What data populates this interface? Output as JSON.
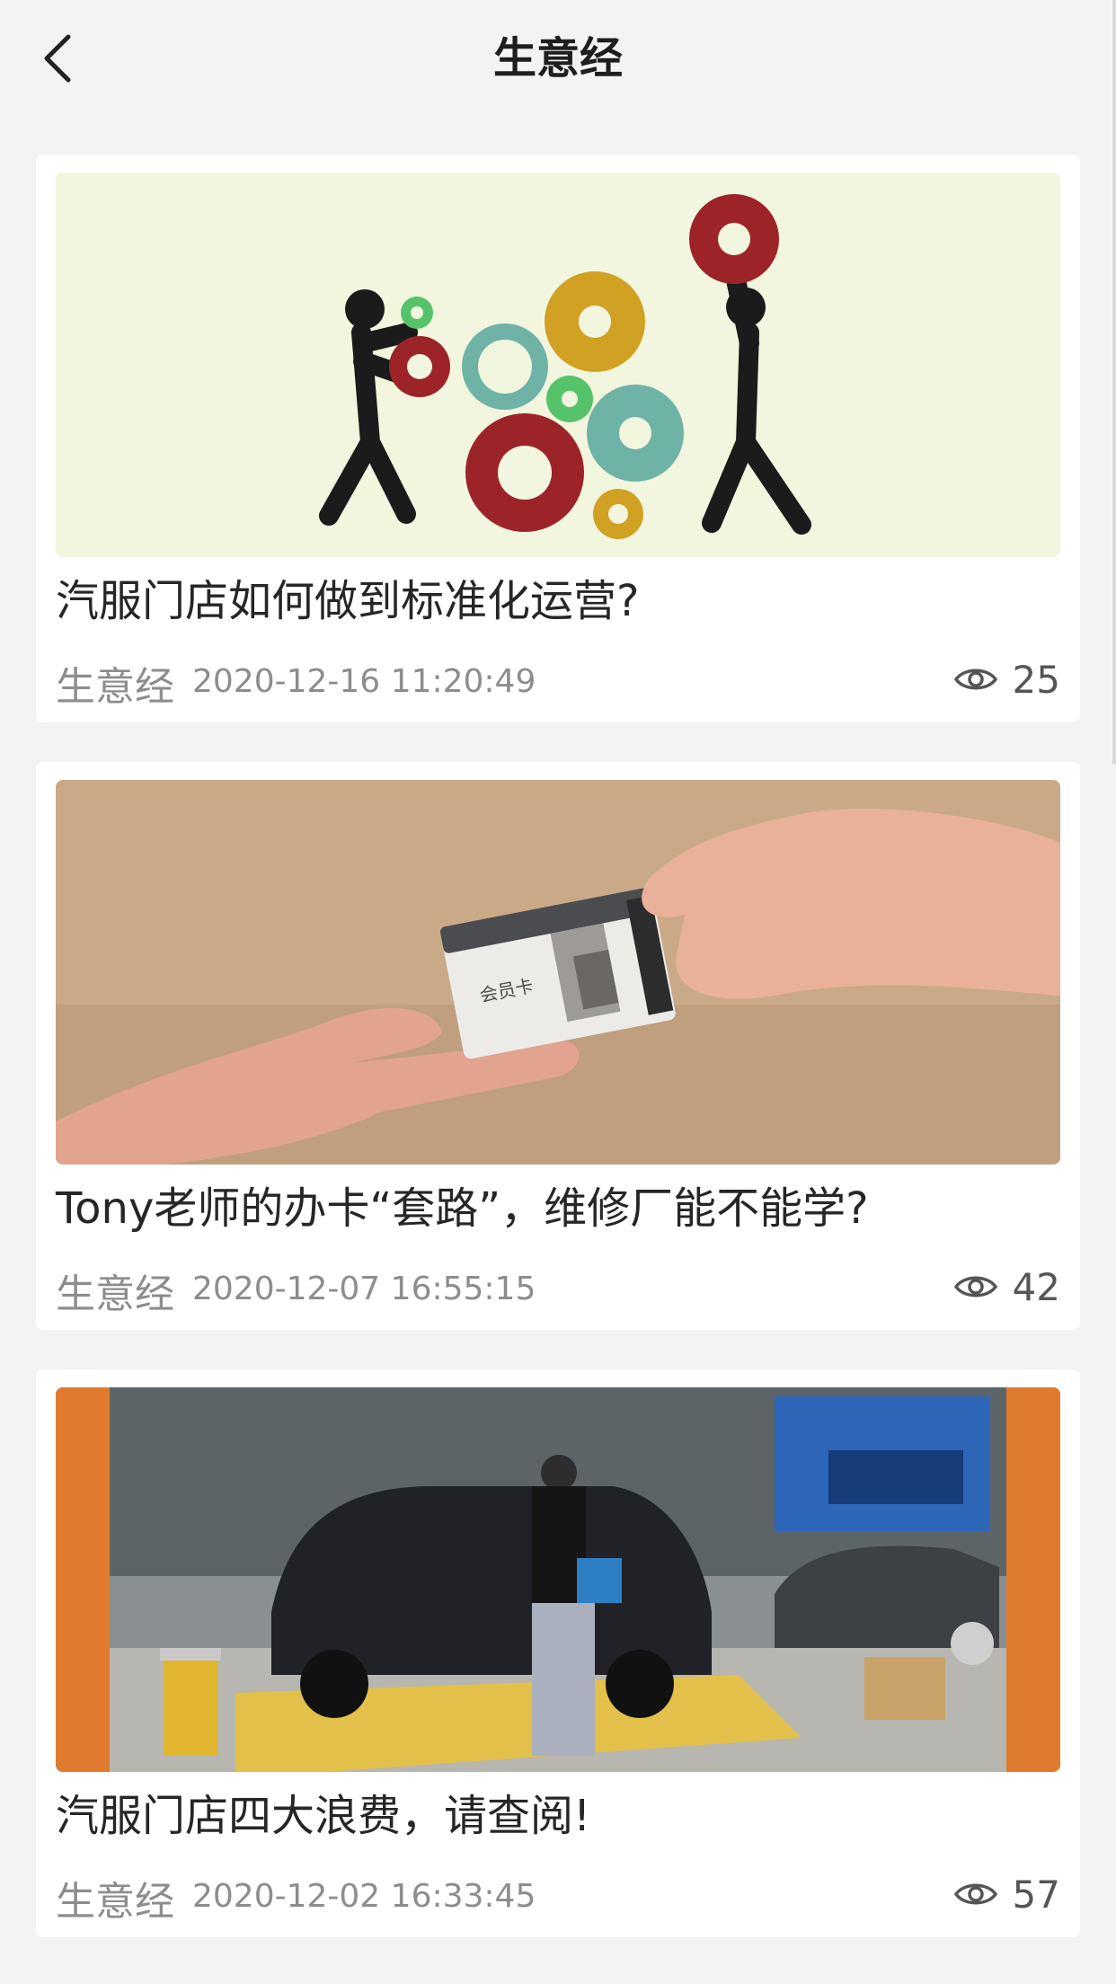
{
  "header": {
    "title": "生意经"
  },
  "articles": [
    {
      "title": "汽服门店如何做到标准化运营?",
      "source": "生意经",
      "date": "2020-12-16 11:20:49",
      "views": "25",
      "image": "gears-illustration"
    },
    {
      "title": "Tony老师的办卡“套路”，维修厂能不能学?",
      "source": "生意经",
      "date": "2020-12-07 16:55:15",
      "views": "42",
      "image": "hands-membership-card-photo"
    },
    {
      "title": "汽服门店四大浪费，请查阅!",
      "source": "生意经",
      "date": "2020-12-02 16:33:45",
      "views": "57",
      "image": "car-service-shop-photo"
    }
  ],
  "card_photo_label": "会员卡",
  "icons": {
    "back": "chevron-left-icon",
    "views": "eye-icon"
  },
  "colors": {
    "background": "#f3f3f3",
    "card": "#ffffff",
    "meta_text": "#8d8d8d"
  }
}
